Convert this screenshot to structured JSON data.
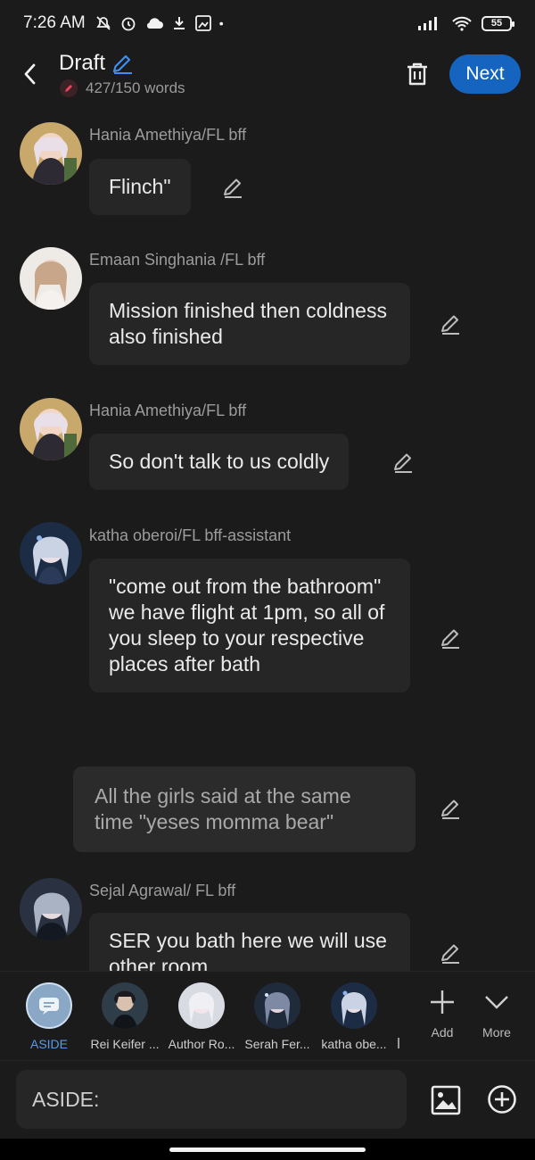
{
  "status_bar": {
    "time": "7:26 AM",
    "battery": "55"
  },
  "header": {
    "title": "Draft",
    "word_count": "427/150 words",
    "next_label": "Next"
  },
  "messages": [
    {
      "author": "Hania Amethiya/FL bff",
      "text": "Flinch\""
    },
    {
      "author": "Emaan Singhania /FL bff",
      "text": "Mission finished then coldness also finished"
    },
    {
      "author": "Hania Amethiya/FL bff",
      "text": "So don't talk to us coldly"
    },
    {
      "author": "katha oberoi/FL bff-assistant",
      "text": "\"come out from the bathroom\" we have flight at 1pm, so all of you sleep to your respective places after bath"
    },
    {
      "aside": "All the girls said at the same time \"yeses momma bear\""
    },
    {
      "author": "Sejal Agrawal/ FL bff",
      "text": "SER you bath here we will use other room"
    }
  ],
  "characters": [
    {
      "label": "ASIDE"
    },
    {
      "label": "Rei Keifer ..."
    },
    {
      "label": "Author Ro..."
    },
    {
      "label": "Serah Fer..."
    },
    {
      "label": "katha obe..."
    }
  ],
  "tools": {
    "add": "Add",
    "more": "More"
  },
  "input": {
    "placeholder": "ASIDE:"
  },
  "colors": {
    "accent": "#1565c0",
    "background": "#1b1b1b",
    "bubble": "#262626"
  }
}
